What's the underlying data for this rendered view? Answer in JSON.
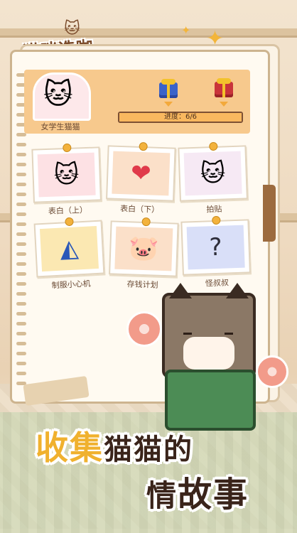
{
  "app": {
    "logo_text": "猫咪造咖"
  },
  "header": {
    "character_name": "女学生猫猫",
    "progress_text": "进度：6/6",
    "progress_value": 1.0
  },
  "cards": [
    {
      "label": "表白（上）",
      "icon": "cat-in-uniform"
    },
    {
      "label": "表白（下）",
      "icon": "heartbeat-heart"
    },
    {
      "label": "拍贴",
      "icon": "cat-with-bow"
    },
    {
      "label": "制服小心机",
      "icon": "blue-pleated-skirt"
    },
    {
      "label": "存钱计划",
      "icon": "pink-piggy-bank"
    },
    {
      "label": "怪叔叔",
      "icon": "shadow-cat-question"
    }
  ],
  "slogan": {
    "line1_highlight": "收集",
    "line1_rest": "猫猫的",
    "line2_rest": "情",
    "line2_highlight": "故事"
  },
  "colors": {
    "progress_fill": "#f9b85f",
    "header_bg": "#f7c98d",
    "slogan_accent": "#f0b12e"
  }
}
